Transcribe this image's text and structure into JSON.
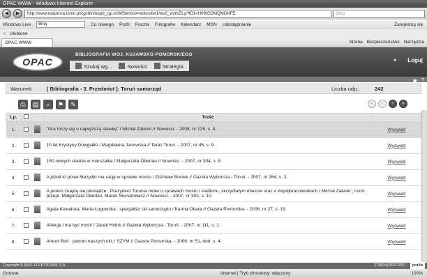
{
  "window": {
    "title": "OPAC WWW - Windows Internet Explorer"
  },
  "browser": {
    "url": "http://www.ksiaznica.torun.pl/cgi-bin/wspd_cgi.sh/WService=wsbroker1/wo2_wzmZ1.p?ID1=H0IKGDMQMGNFE",
    "search_placeholder": "Bing",
    "live_label": "Windows Live",
    "live_search": "Bing",
    "live_links": [
      "Co nowego",
      "Profil",
      "Poczta",
      "Fotografie",
      "Kalendarz",
      "MSN",
      "Udostępnianie"
    ],
    "signin": "Zarejestruj się",
    "favorites": "Ulubione",
    "tab_title": "OPAC WWW",
    "cmd_page": "Strona",
    "cmd_security": "Bezpieczeństwo",
    "cmd_tools": "Narzędzia"
  },
  "opac": {
    "logo": "OPAC",
    "database": "BIBLIOGRAFIA WOJ. KUJAWSKO-POMORSKIEGO",
    "nav": [
      "Szukaj wg...",
      "Nowości",
      "Strategia"
    ],
    "login": "Loguj"
  },
  "query": {
    "label": "Warunek:",
    "condition": "[ Bibliografia - 3. Przedmiot ]: Toruń samorząd",
    "count_label": "Liczba odp.:",
    "count": "242"
  },
  "table": {
    "headers": {
      "lp": "Lp.",
      "content": "Treść"
    },
    "action_label": "Wyświetl",
    "rows": [
      {
        "lp": "1.",
        "text": "\"Gra toczy się o najwyższą stawkę\" / Michał Zaleski.// Nowości. - 2008, nr 125, s. 4."
      },
      {
        "lp": "2.",
        "text": "10 lat Krystyny Dowgiałło / Magdalena Janowska.// Teraz Toruń. - 2007, nr 45, s. 9."
      },
      {
        "lp": "3.",
        "text": "150 nowych etatów w marszałka / Małgorzata Oberlan.// Nowości. - 2007, nr 304, s. 8."
      },
      {
        "lp": "4.",
        "text": "A jeżeli to poseł Meżydło ma rację w sprawie mostu / Zdzisław Bociek.// Gazeta Wyborcza - Toruń. - 2007, nr 264, s. 2."
      },
      {
        "lp": "5.",
        "text": "A potem znajdą się pieniądze : Prezydent Toruniа mówi o sprawach mostu i stadionu, skrzydlatym mieście oraz o współpracownikach / Michał Zaleski ; rozm. przepr. Małgorzata Oberlan, Marek Nienartowicz.// Nowości. - 2007, nr 302, s. 10."
      },
      {
        "lp": "6.",
        "text": "Agata Kowalska, Marta Ługowska : specjaliści od samorządu / Karina Obara.// Gazeta Pomorska. - 2006, nr 27, s. 15."
      },
      {
        "lp": "7.",
        "text": "Alleluja i ma być most! / Jacek Hołub.// Gazeta Wyborcza - Toruń. - 2007, nr 111, s. 1."
      },
      {
        "lp": "8.",
        "text": "Antoni Bolt : patroni naszych ulic / SZYM.// Gazeta Pomorska. - 2006, nr 51, dod. s. 4."
      }
    ]
  },
  "footer": {
    "copyright": "Copyright © MAX ELEKTRONIK S.A.",
    "session": "2738041851F0357",
    "badge": "prolib"
  },
  "statusbar": {
    "left": "Gotowe",
    "zone": "Internet | Tryb chroniony: włączony",
    "zoom": "100%"
  }
}
